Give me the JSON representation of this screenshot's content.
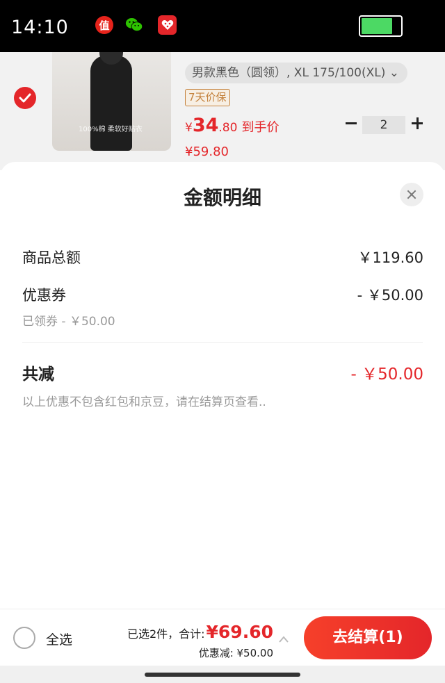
{
  "status_bar": {
    "time": "14:10",
    "apps": [
      {
        "name": "zhi-app-icon",
        "glyph": "值"
      },
      {
        "name": "wechat-app-icon"
      },
      {
        "name": "jd-app-icon"
      }
    ],
    "battery_level": 0.8
  },
  "cart_item": {
    "checked": true,
    "image_caption": "100%棉 柔软好贴衣",
    "sku": "男款黑色（圆领）, XL 175/100(XL) ⌄",
    "tag": "7天价保",
    "price_symbol": "¥",
    "price_int": "34",
    "price_dec": ".80",
    "price_suffix": "到手价",
    "original_price": "¥59.80",
    "quantity": "2"
  },
  "sheet": {
    "title": "金额明细",
    "rows": {
      "goods_total_label": "商品总额",
      "goods_total_value": "￥119.60",
      "coupon_label": "优惠券",
      "coupon_value": "- ￥50.00",
      "coupon_sub": "已领券 - ￥50.00",
      "total_reduce_label": "共减",
      "total_reduce_value": "- ￥50.00"
    },
    "note": "以上优惠不包含红包和京豆，请在结算页查看.."
  },
  "bottom_bar": {
    "select_all_label": "全选",
    "selected_text": "已选2件，合计:",
    "total": "¥69.60",
    "discount_text": "优惠减: ¥50.00",
    "checkout_label": "去结算(1)"
  },
  "colors": {
    "accent": "#e4262a",
    "tag_brown": "#c4823d",
    "battery_green": "#4cd964"
  }
}
